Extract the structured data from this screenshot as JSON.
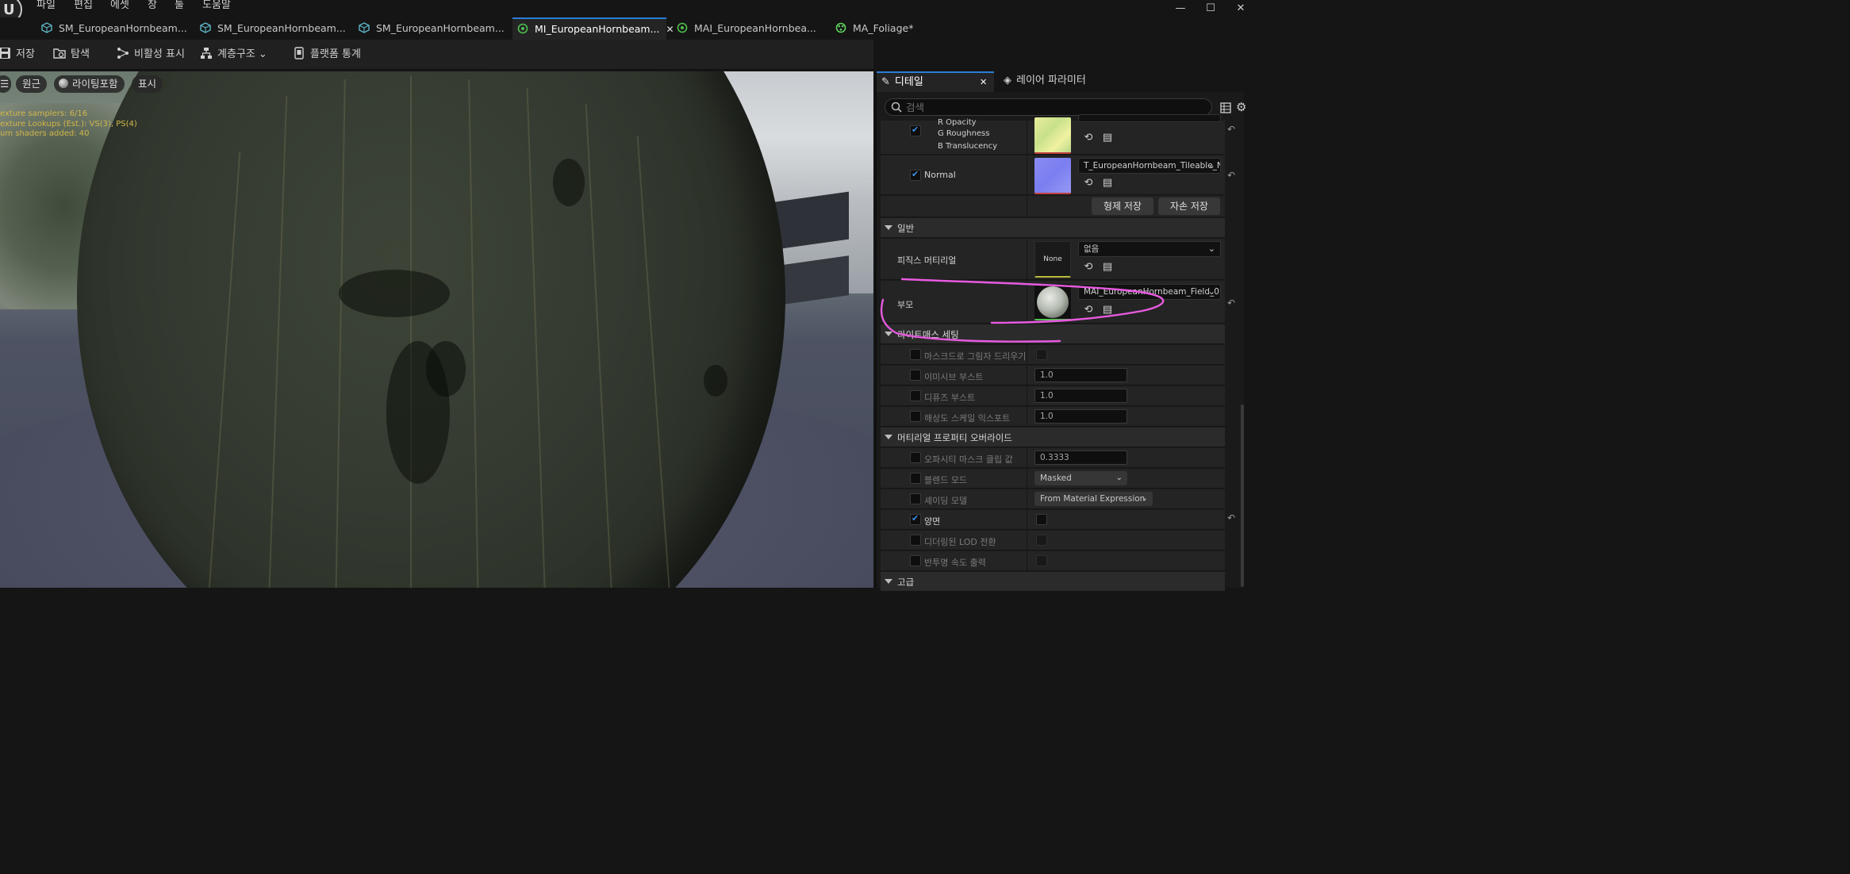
{
  "menu": [
    "파일",
    "편집",
    "에셋",
    "창",
    "툴",
    "도움말"
  ],
  "window_controls": {
    "minimize": "—",
    "maximize": "☐",
    "close": "✕"
  },
  "tabs": [
    {
      "label": "SM_EuropeanHornbeam...",
      "icon": "static-mesh-icon"
    },
    {
      "label": "SM_EuropeanHornbeam...",
      "icon": "static-mesh-icon"
    },
    {
      "label": "SM_EuropeanHornbeam...",
      "icon": "static-mesh-icon"
    },
    {
      "label": "MI_EuropeanHornbeam...",
      "icon": "material-instance-icon",
      "active": true,
      "close": "✕"
    },
    {
      "label": "MAI_EuropeanHornbea...",
      "icon": "material-instance-icon"
    },
    {
      "label": "MA_Foliage*",
      "icon": "material-icon"
    }
  ],
  "toolbar": {
    "save": "저장",
    "browse": "탐색",
    "hide_inactive": "비활성 표시",
    "hierarchy": "계층구조",
    "platform_stats": "플랫폼 통계"
  },
  "viewport": {
    "menu_icon": "☰",
    "perspective": "원근",
    "lit": "라이팅포함",
    "show": "표시",
    "stats": [
      "exture samplers: 6/16",
      "exture Lookups (Est.): VS(3), PS(4)",
      "um shaders added: 40"
    ]
  },
  "details": {
    "tab_details": "디테일",
    "tab_details_close": "✕",
    "tab_layer_params": "레이어 파라미터",
    "search_placeholder": "검색",
    "texture_rows": {
      "channel_r": "R  Opacity",
      "channel_g": "G  Roughness",
      "channel_b": "B  Translucency",
      "normal_label": "Normal",
      "normal_value": "T_EuropeanHornbeam_Tileable_N"
    },
    "save_sibling": "형제 저장",
    "save_child": "자손 저장",
    "section_general": "일반",
    "phys_material_label": "피직스 머티리얼",
    "phys_material_thumb": "None",
    "phys_material_value": "없음",
    "parent_label": "부모",
    "parent_value": "MAI_EuropeanHornbeam_Field_0",
    "section_lightmass": "라이트매스 세팅",
    "lightmass": [
      {
        "label": "마스크드로 그림자 드리우기",
        "type": "checkbox"
      },
      {
        "label": "이미시브 부스트",
        "value": "1.0"
      },
      {
        "label": "디퓨즈 부스트",
        "value": "1.0"
      },
      {
        "label": "해상도 스케일 익스포트",
        "value": "1.0"
      }
    ],
    "section_overrides": "머티리얼 프로퍼티 오버라이드",
    "overrides": [
      {
        "label": "오파시티 마스크 클립 값",
        "value": "0.3333"
      },
      {
        "label": "블렌드 모드",
        "value": "Masked"
      },
      {
        "label": "셰이딩 모델",
        "value": "From Material Expression"
      },
      {
        "label": "양면"
      },
      {
        "label": "디더링된 LOD 전환"
      },
      {
        "label": "반투명 속도 출력"
      }
    ],
    "section_advanced": "고급"
  },
  "colors": {
    "accent": "#2a7dd6",
    "annotation": "#e85ae0",
    "stats_text": "#d2b74a"
  }
}
